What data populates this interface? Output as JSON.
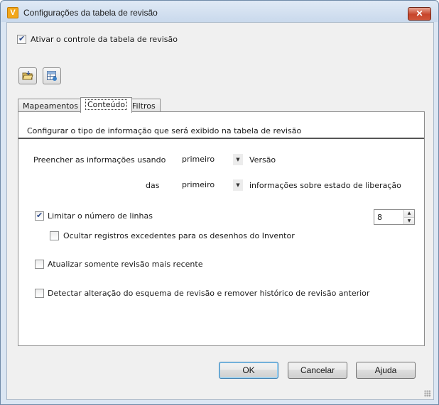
{
  "window": {
    "title": "Configurações da tabela de revisão",
    "icon_letter": "V",
    "close_symbol": "✕"
  },
  "enable_control": {
    "label": "Ativar o controle da tabela de revisão",
    "checked": true
  },
  "tabs": [
    {
      "label": "Mapeamentos",
      "active": false
    },
    {
      "label": "Conteúdo",
      "active": true
    },
    {
      "label": "Filtros",
      "active": false
    }
  ],
  "content": {
    "header": "Configurar o tipo de informação que será exibido na tabela de revisão",
    "fill_label": "Preencher as informações usando",
    "fill_combo_value": "primeiro",
    "fill_suffix": "Versão",
    "das_label": "das",
    "das_combo_value": "primeiro",
    "das_suffix": "informações sobre estado de liberação",
    "limit_rows": {
      "label": "Limitar o número de linhas",
      "checked": true,
      "value": "8"
    },
    "hide_excess": {
      "label": "Ocultar registros excedentes para os desenhos do Inventor",
      "checked": false
    },
    "update_latest": {
      "label": "Atualizar somente revisão mais recente",
      "checked": false
    },
    "detect_change": {
      "label": "Detectar alteração do esquema de revisão e remover histórico de revisão anterior",
      "checked": false
    }
  },
  "buttons": {
    "ok": "OK",
    "cancel": "Cancelar",
    "help": "Ajuda"
  }
}
